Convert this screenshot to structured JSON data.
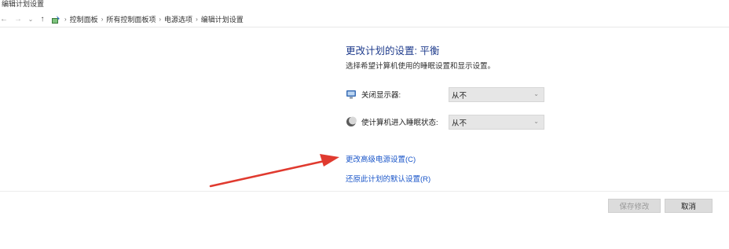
{
  "window": {
    "title": "编辑计划设置"
  },
  "addressbar": {
    "breadcrumbs": [
      "控制面板",
      "所有控制面板项",
      "电源选项",
      "编辑计划设置"
    ]
  },
  "main": {
    "heading": "更改计划的设置: 平衡",
    "subheading": "选择希望计算机使用的睡眠设置和显示设置。",
    "settings": [
      {
        "label": "关闭显示器:",
        "value": "从不",
        "icon": "monitor-icon"
      },
      {
        "label": "使计算机进入睡眠状态:",
        "value": "从不",
        "icon": "moon-icon"
      }
    ],
    "links": {
      "advanced": "更改高级电源设置(C)",
      "restore": "还原此计划的默认设置(R)"
    }
  },
  "footer": {
    "save_label": "保存修改",
    "cancel_label": "取消"
  },
  "colors": {
    "heading": "#1e3b8c",
    "link": "#1a56c9",
    "annotation_arrow": "#e03a2f"
  }
}
